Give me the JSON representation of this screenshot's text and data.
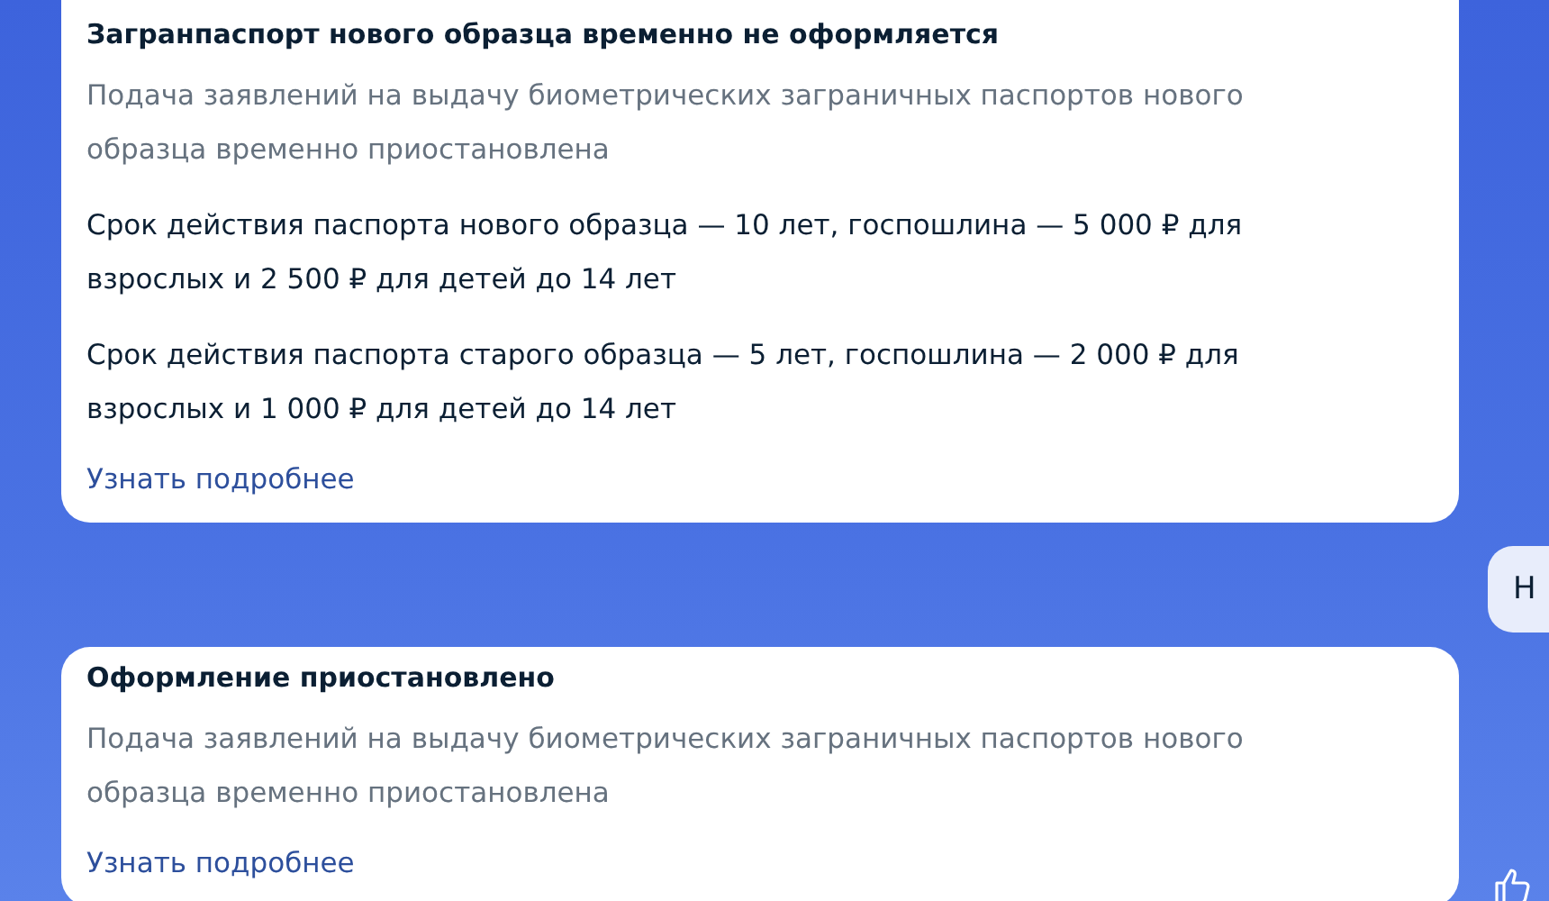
{
  "messages": [
    {
      "kind": "card",
      "title": "Загранпаспорт нового образца временно не оформляется",
      "paragraphs": [
        {
          "muted": true,
          "text": "Подача заявлений на выдачу биометрических заграничных паспортов нового образца временно приостановлена"
        },
        {
          "muted": false,
          "text": "Срок действия паспорта нового образца — 10 лет, госпошлина — 5 000 ₽ для взрослых и 2 500 ₽ для детей до 14 лет"
        },
        {
          "muted": false,
          "text": "Срок действия паспорта старого образца — 5 лет, госпошлина — 2 000 ₽ для взрослых и 1 000 ₽ для детей до 14 лет"
        }
      ],
      "link": "Узнать подробнее"
    },
    {
      "kind": "user",
      "text": "Н"
    },
    {
      "kind": "card",
      "title": "Оформление приостановлено",
      "paragraphs": [
        {
          "muted": true,
          "text": "Подача заявлений на выдачу биометрических заграничных паспортов нового образца временно приостановлена"
        }
      ],
      "link": "Узнать подробнее"
    }
  ]
}
